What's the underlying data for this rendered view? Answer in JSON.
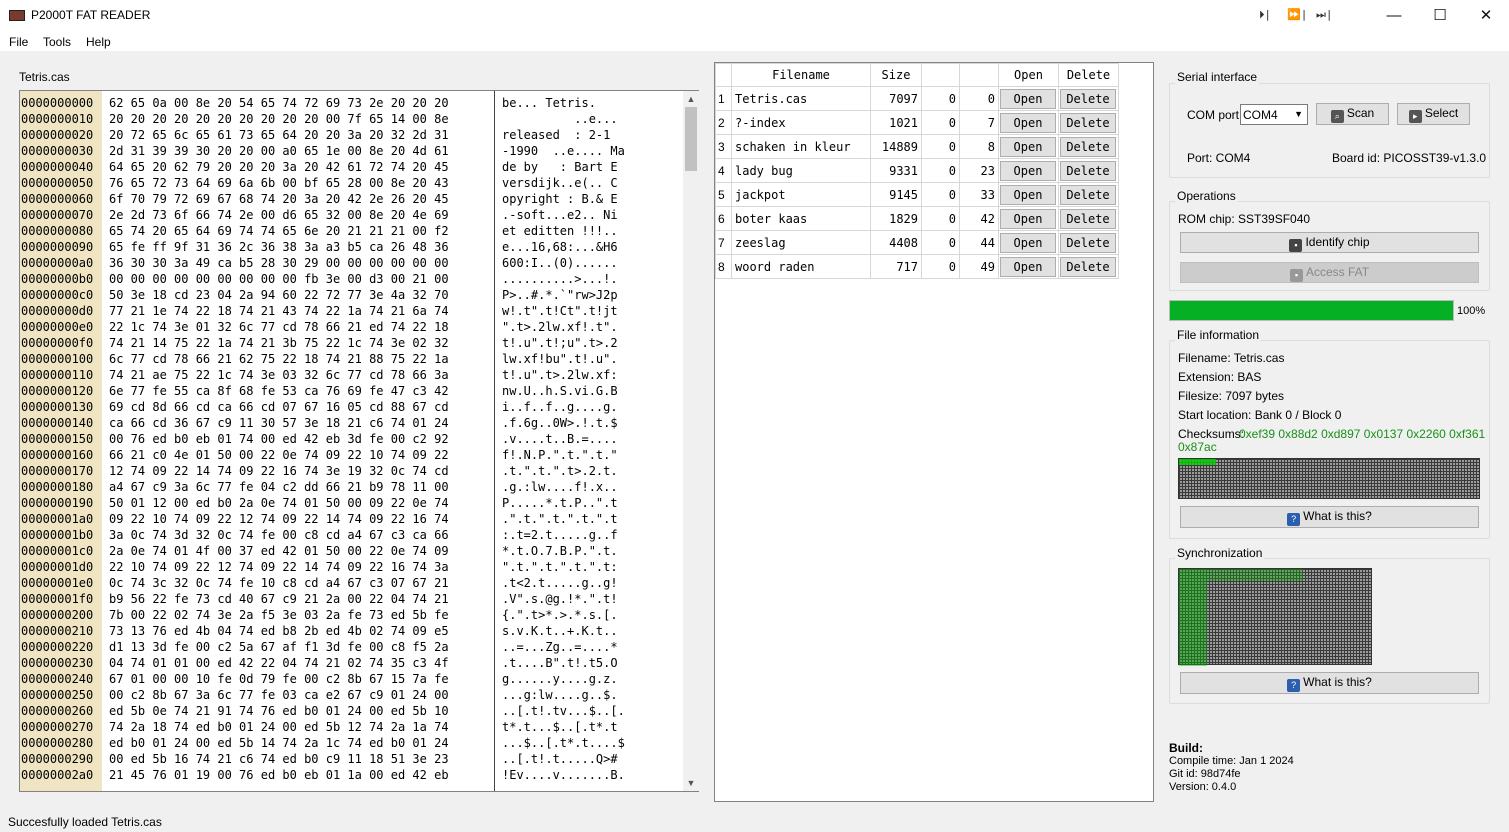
{
  "window": {
    "title": "P2000T FAT READER",
    "min": "—",
    "max": "☐",
    "close": "✕",
    "tb_icons": [
      "⏵|",
      "⏩|",
      "⏭|"
    ]
  },
  "menu": [
    "File",
    "Tools",
    "Help"
  ],
  "hex": {
    "filename": "Tetris.cas",
    "addresses": [
      "0000000000",
      "0000000010",
      "0000000020",
      "0000000030",
      "0000000040",
      "0000000050",
      "0000000060",
      "0000000070",
      "0000000080",
      "0000000090",
      "00000000a0",
      "00000000b0",
      "00000000c0",
      "00000000d0",
      "00000000e0",
      "00000000f0",
      "0000000100",
      "0000000110",
      "0000000120",
      "0000000130",
      "0000000140",
      "0000000150",
      "0000000160",
      "0000000170",
      "0000000180",
      "0000000190",
      "00000001a0",
      "00000001b0",
      "00000001c0",
      "00000001d0",
      "00000001e0",
      "00000001f0",
      "0000000200",
      "0000000210",
      "0000000220",
      "0000000230",
      "0000000240",
      "0000000250",
      "0000000260",
      "0000000270",
      "0000000280",
      "0000000290",
      "00000002a0"
    ],
    "bytes": [
      "62 65 0a 00 8e 20 54 65 74 72 69 73 2e 20 20 20",
      "20 20 20 20 20 20 20 20 20 20 00 7f 65 14 00 8e",
      "20 72 65 6c 65 61 73 65 64 20 20 3a 20 32 2d 31",
      "2d 31 39 39 30 20 20 00 a0 65 1e 00 8e 20 4d 61",
      "64 65 20 62 79 20 20 20 3a 20 42 61 72 74 20 45",
      "76 65 72 73 64 69 6a 6b 00 bf 65 28 00 8e 20 43",
      "6f 70 79 72 69 67 68 74 20 3a 20 42 2e 26 20 45",
      "2e 2d 73 6f 66 74 2e 00 d6 65 32 00 8e 20 4e 69",
      "65 74 20 65 64 69 74 74 65 6e 20 21 21 21 00 f2",
      "65 fe ff 9f 31 36 2c 36 38 3a a3 b5 ca 26 48 36",
      "36 30 30 3a 49 ca b5 28 30 29 00 00 00 00 00 00",
      "00 00 00 00 00 00 00 00 00 fb 3e 00 d3 00 21 00",
      "50 3e 18 cd 23 04 2a 94 60 22 72 77 3e 4a 32 70",
      "77 21 1e 74 22 18 74 21 43 74 22 1a 74 21 6a 74",
      "22 1c 74 3e 01 32 6c 77 cd 78 66 21 ed 74 22 18",
      "74 21 14 75 22 1a 74 21 3b 75 22 1c 74 3e 02 32",
      "6c 77 cd 78 66 21 62 75 22 18 74 21 88 75 22 1a",
      "74 21 ae 75 22 1c 74 3e 03 32 6c 77 cd 78 66 3a",
      "6e 77 fe 55 ca 8f 68 fe 53 ca 76 69 fe 47 c3 42",
      "69 cd 8d 66 cd ca 66 cd 07 67 16 05 cd 88 67 cd",
      "ca 66 cd 36 67 c9 11 30 57 3e 18 21 c6 74 01 24",
      "00 76 ed b0 eb 01 74 00 ed 42 eb 3d fe 00 c2 92",
      "66 21 c0 4e 01 50 00 22 0e 74 09 22 10 74 09 22",
      "12 74 09 22 14 74 09 22 16 74 3e 19 32 0c 74 cd",
      "a4 67 c9 3a 6c 77 fe 04 c2 dd 66 21 b9 78 11 00",
      "50 01 12 00 ed b0 2a 0e 74 01 50 00 09 22 0e 74",
      "09 22 10 74 09 22 12 74 09 22 14 74 09 22 16 74",
      "3a 0c 74 3d 32 0c 74 fe 00 c8 cd a4 67 c3 ca 66",
      "2a 0e 74 01 4f 00 37 ed 42 01 50 00 22 0e 74 09",
      "22 10 74 09 22 12 74 09 22 14 74 09 22 16 74 3a",
      "0c 74 3c 32 0c 74 fe 10 c8 cd a4 67 c3 07 67 21",
      "b9 56 22 fe 73 cd 40 67 c9 21 2a 00 22 04 74 21",
      "7b 00 22 02 74 3e 2a f5 3e 03 2a fe 73 ed 5b fe",
      "73 13 76 ed 4b 04 74 ed b8 2b ed 4b 02 74 09 e5",
      "d1 13 3d fe 00 c2 5a 67 af f1 3d fe 00 c8 f5 2a",
      "04 74 01 01 00 ed 42 22 04 74 21 02 74 35 c3 4f",
      "67 01 00 00 10 fe 0d 79 fe 00 c2 8b 67 15 7a fe",
      "00 c2 8b 67 3a 6c 77 fe 03 ca e2 67 c9 01 24 00",
      "ed 5b 0e 74 21 91 74 76 ed b0 01 24 00 ed 5b 10",
      "74 2a 18 74 ed b0 01 24 00 ed 5b 12 74 2a 1a 74",
      "ed b0 01 24 00 ed 5b 14 74 2a 1c 74 ed b0 01 24",
      "00 ed 5b 16 74 21 c6 74 ed b0 c9 11 18 51 3e 23",
      "21 45 76 01 19 00 76 ed b0 eb 01 1a 00 ed 42 eb"
    ],
    "ascii": [
      "be... Tetris.",
      "          ..e...",
      "released  : 2-1",
      "-1990  ..e.... Ma",
      "de by   : Bart E",
      "versdijk..e(.. C",
      "opyright : B.& E",
      ".-soft...e2.. Ni",
      "et editten !!!..",
      "e...16,68:...&H6",
      "600:I..(0)......",
      "..........>...!.",
      "P>..#.*.`\"rw>J2p",
      "w!.t\".t!Ct\".t!jt",
      "\".t>.2lw.xf!.t\".",
      "t!.u\".t!;u\".t>.2",
      "lw.xf!bu\".t!.u\".",
      "t!.u\".t>.2lw.xf:",
      "nw.U..h.S.vi.G.B",
      "i..f..f..g....g.",
      ".f.6g..0W>.!.t.$",
      ".v....t..B.=....",
      "f!.N.P.\".t.\".t.\"",
      ".t.\".t.\".t>.2.t.",
      ".g.:lw....f!.x..",
      "P.....*.t.P..\".t",
      ".\".t.\".t.\".t.\".t",
      ":.t=2.t.....g..f",
      "*.t.O.7.B.P.\".t.",
      "\".t.\".t.\".t.\".t:",
      ".t<2.t.....g..g!",
      ".V\".s.@g.!*.\".t!",
      "{.\".t>*.>.*.s.[.",
      "s.v.K.t..+.K.t..",
      "..=...Zg..=....*",
      ".t....B\".t!.t5.O",
      "g......y....g.z.",
      "...g:lw....g..$.",
      "..[.t!.tv...$..[.",
      "t*.t...$..[.t*.t",
      "...$..[.t*.t....$",
      "..[.t!.t.....Q>#",
      "!Ev....v.......B."
    ]
  },
  "files": {
    "headers": [
      "",
      "Filename",
      "Size",
      "",
      "",
      "Open",
      "Delete"
    ],
    "rows": [
      {
        "idx": "1",
        "name": "Tetris.cas",
        "size": "7097",
        "a": "0",
        "b": "0"
      },
      {
        "idx": "2",
        "name": "?-index",
        "size": "1021",
        "a": "0",
        "b": "7"
      },
      {
        "idx": "3",
        "name": "schaken in kleur",
        "size": "14889",
        "a": "0",
        "b": "8"
      },
      {
        "idx": "4",
        "name": "lady bug",
        "size": "9331",
        "a": "0",
        "b": "23"
      },
      {
        "idx": "5",
        "name": "jackpot",
        "size": "9145",
        "a": "0",
        "b": "33"
      },
      {
        "idx": "6",
        "name": "boter kaas",
        "size": "1829",
        "a": "0",
        "b": "42"
      },
      {
        "idx": "7",
        "name": "zeeslag",
        "size": "4408",
        "a": "0",
        "b": "44"
      },
      {
        "idx": "8",
        "name": "woord raden",
        "size": "717",
        "a": "0",
        "b": "49"
      }
    ],
    "open_label": "Open",
    "delete_label": "Delete"
  },
  "serial": {
    "title": "Serial interface",
    "com_label": "COM port",
    "com_value": "COM4",
    "scan": "Scan",
    "select": "Select",
    "port": "Port: COM4",
    "board": "Board id: PICOSST39-v1.3.0"
  },
  "ops": {
    "title": "Operations",
    "rom": "ROM chip: SST39SF040",
    "identify": "Identify chip",
    "access": "Access FAT"
  },
  "progress": {
    "value": 1.0,
    "label": "100%",
    "color": "#06b025"
  },
  "fileinfo": {
    "title": "File information",
    "filename": "Filename: Tetris.cas",
    "extension": "Extension: BAS",
    "filesize": "Filesize: 7097 bytes",
    "start": "Start location: Bank 0 / Block 0",
    "checksums_label": "Checksums:",
    "checksums1": "0xef39 0x88d2 0xd897 0x0137 0x2260 0xf361",
    "checksums2": "0x87ac",
    "whatis": "What is this?"
  },
  "sync": {
    "title": "Synchronization",
    "whatis": "What is this?"
  },
  "build": {
    "title": "Build:",
    "compile": "Compile time: Jan 1 2024",
    "git": "Git id: 98d74fe",
    "version": "Version: 0.4.0"
  },
  "status": "Succesfully loaded Tetris.cas",
  "colors": {
    "address_bg": "#efe5c3",
    "progress": "#06b025",
    "checksum": "#1a8f1a",
    "help_icon": "#2b5fad"
  }
}
